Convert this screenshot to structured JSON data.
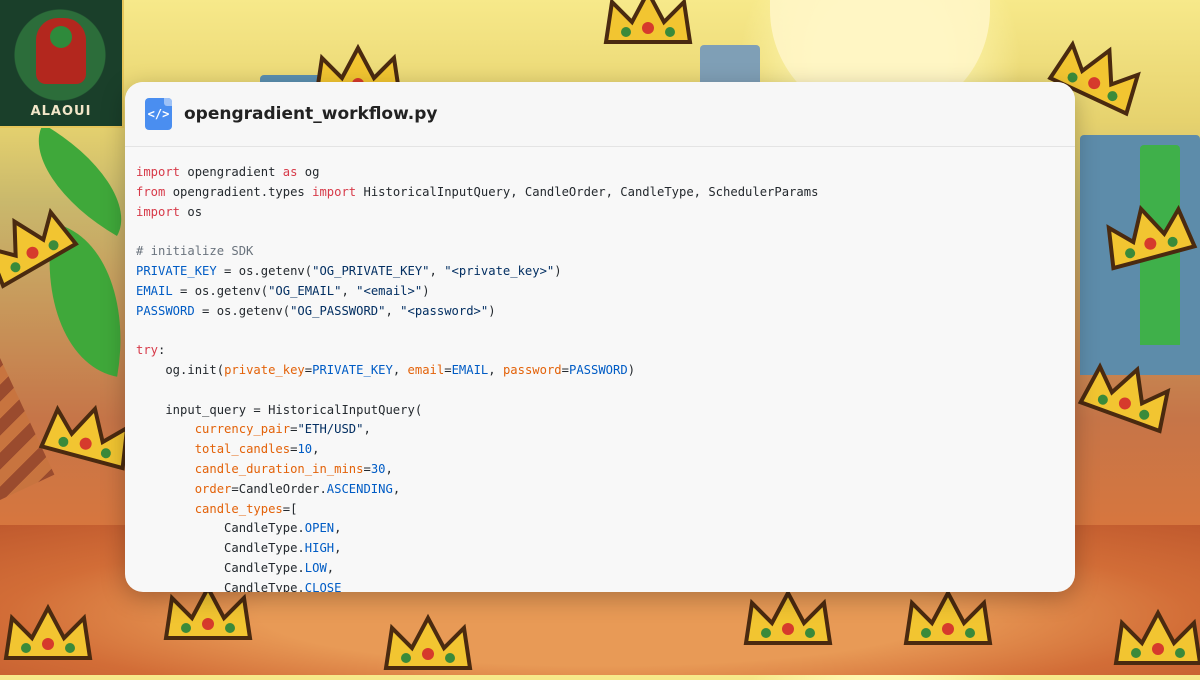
{
  "brand": {
    "name": "ALAOUI"
  },
  "file": {
    "icon": "</>",
    "name": "opengradient_workflow.py"
  },
  "code": {
    "lines": [
      [
        {
          "t": "import",
          "c": "kw"
        },
        {
          "t": " opengradient "
        },
        {
          "t": "as",
          "c": "kw"
        },
        {
          "t": " og"
        }
      ],
      [
        {
          "t": "from",
          "c": "kw"
        },
        {
          "t": " opengradient.types "
        },
        {
          "t": "import",
          "c": "kw"
        },
        {
          "t": " HistoricalInputQuery, CandleOrder, CandleType, SchedulerParams"
        }
      ],
      [
        {
          "t": "import",
          "c": "kw"
        },
        {
          "t": " os"
        }
      ],
      [],
      [
        {
          "t": "# initialize SDK",
          "c": "cm"
        }
      ],
      [
        {
          "t": "PRIVATE_KEY",
          "c": "cn"
        },
        {
          "t": " = os.getenv("
        },
        {
          "t": "\"OG_PRIVATE_KEY\"",
          "c": "st"
        },
        {
          "t": ", "
        },
        {
          "t": "\"<private_key>\"",
          "c": "st"
        },
        {
          "t": ")"
        }
      ],
      [
        {
          "t": "EMAIL",
          "c": "cn"
        },
        {
          "t": " = os.getenv("
        },
        {
          "t": "\"OG_EMAIL\"",
          "c": "st"
        },
        {
          "t": ", "
        },
        {
          "t": "\"<email>\"",
          "c": "st"
        },
        {
          "t": ")"
        }
      ],
      [
        {
          "t": "PASSWORD",
          "c": "cn"
        },
        {
          "t": " = os.getenv("
        },
        {
          "t": "\"OG_PASSWORD\"",
          "c": "st"
        },
        {
          "t": ", "
        },
        {
          "t": "\"<password>\"",
          "c": "st"
        },
        {
          "t": ")"
        }
      ],
      [],
      [
        {
          "t": "try",
          "c": "kw"
        },
        {
          "t": ":"
        }
      ],
      [
        {
          "t": "    og.init("
        },
        {
          "t": "private_key",
          "c": "pr"
        },
        {
          "t": "="
        },
        {
          "t": "PRIVATE_KEY",
          "c": "cn"
        },
        {
          "t": ", "
        },
        {
          "t": "email",
          "c": "pr"
        },
        {
          "t": "="
        },
        {
          "t": "EMAIL",
          "c": "cn"
        },
        {
          "t": ", "
        },
        {
          "t": "password",
          "c": "pr"
        },
        {
          "t": "="
        },
        {
          "t": "PASSWORD",
          "c": "cn"
        },
        {
          "t": ")"
        }
      ],
      [],
      [
        {
          "t": "    input_query = HistoricalInputQuery("
        }
      ],
      [
        {
          "t": "        "
        },
        {
          "t": "currency_pair",
          "c": "pr"
        },
        {
          "t": "="
        },
        {
          "t": "\"ETH/USD\"",
          "c": "st"
        },
        {
          "t": ","
        }
      ],
      [
        {
          "t": "        "
        },
        {
          "t": "total_candles",
          "c": "pr"
        },
        {
          "t": "="
        },
        {
          "t": "10",
          "c": "cn"
        },
        {
          "t": ","
        }
      ],
      [
        {
          "t": "        "
        },
        {
          "t": "candle_duration_in_mins",
          "c": "pr"
        },
        {
          "t": "="
        },
        {
          "t": "30",
          "c": "cn"
        },
        {
          "t": ","
        }
      ],
      [
        {
          "t": "        "
        },
        {
          "t": "order",
          "c": "pr"
        },
        {
          "t": "=CandleOrder."
        },
        {
          "t": "ASCENDING",
          "c": "cn"
        },
        {
          "t": ","
        }
      ],
      [
        {
          "t": "        "
        },
        {
          "t": "candle_types",
          "c": "pr"
        },
        {
          "t": "=["
        }
      ],
      [
        {
          "t": "            CandleType."
        },
        {
          "t": "OPEN",
          "c": "cn"
        },
        {
          "t": ","
        }
      ],
      [
        {
          "t": "            CandleType."
        },
        {
          "t": "HIGH",
          "c": "cn"
        },
        {
          "t": ","
        }
      ],
      [
        {
          "t": "            CandleType."
        },
        {
          "t": "LOW",
          "c": "cn"
        },
        {
          "t": ","
        }
      ],
      [
        {
          "t": "            CandleType."
        },
        {
          "t": "CLOSE",
          "c": "cn"
        }
      ]
    ]
  },
  "colors": {
    "keyword": "#d73a49",
    "comment": "#6a737d",
    "string": "#032f62",
    "constant": "#005cc5",
    "param": "#e36209",
    "file_icon": "#4a8ef0"
  },
  "icons": {
    "file": "code-file-icon",
    "decor": "crown-icon"
  }
}
